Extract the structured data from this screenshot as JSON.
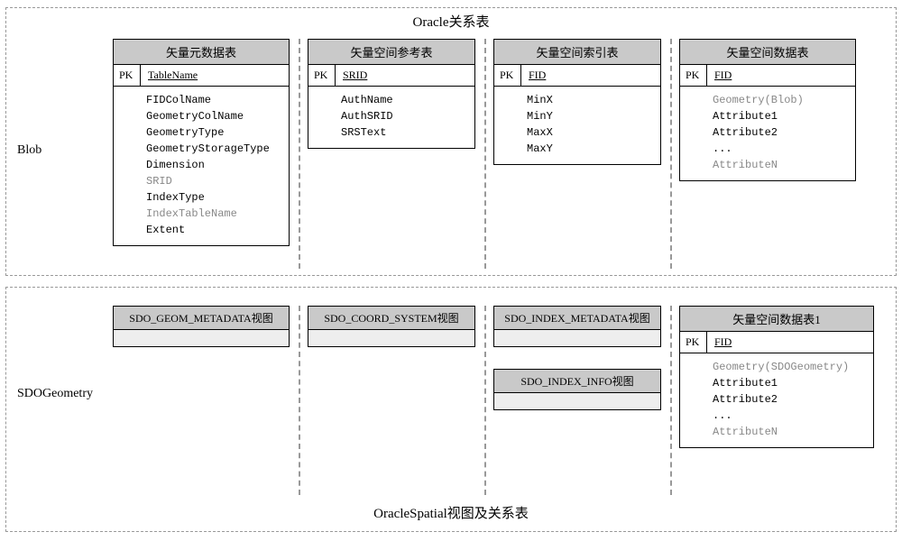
{
  "top": {
    "title": "Oracle关系表",
    "sideLabel": "Blob",
    "tables": [
      {
        "title": "矢量元数据表",
        "pk": "PK",
        "pkVal": "TableName",
        "rows": [
          "FIDColName",
          "GeometryColName",
          "GeometryType",
          "GeometryStorageType",
          "Dimension"
        ],
        "grayMid": "SRID",
        "rows2": [
          "IndexType"
        ],
        "grayMid2": "IndexTableName",
        "rows3": [
          "Extent"
        ]
      },
      {
        "title": "矢量空间参考表",
        "pk": "PK",
        "pkVal": "SRID",
        "rows": [
          "AuthName",
          "AuthSRID",
          "SRSText"
        ]
      },
      {
        "title": "矢量空间索引表",
        "pk": "PK",
        "pkVal": "FID",
        "rows": [
          "MinX",
          "MinY",
          "MaxX",
          "MaxY"
        ]
      },
      {
        "title": "矢量空间数据表",
        "pk": "PK",
        "pkVal": "FID",
        "grayTop": "Geometry(Blob)",
        "rows": [
          "Attribute1",
          "Attribute2",
          "..."
        ],
        "grayBot": "AttributeN"
      }
    ]
  },
  "bot": {
    "title": "OracleSpatial视图及关系表",
    "sideLabel": "SDOGeometry",
    "views": [
      {
        "title": "SDO_GEOM_METADATA视图"
      },
      {
        "title": "SDO_COORD_SYSTEM视图"
      },
      {
        "title": "SDO_INDEX_METADATA视图"
      },
      {
        "title": "SDO_INDEX_INFO视图"
      }
    ],
    "table": {
      "title": "矢量空间数据表1",
      "pk": "PK",
      "pkVal": "FID",
      "grayTop": "Geometry(SDOGeometry)",
      "rows": [
        "Attribute1",
        "Attribute2",
        "..."
      ],
      "grayBot": "AttributeN"
    }
  }
}
